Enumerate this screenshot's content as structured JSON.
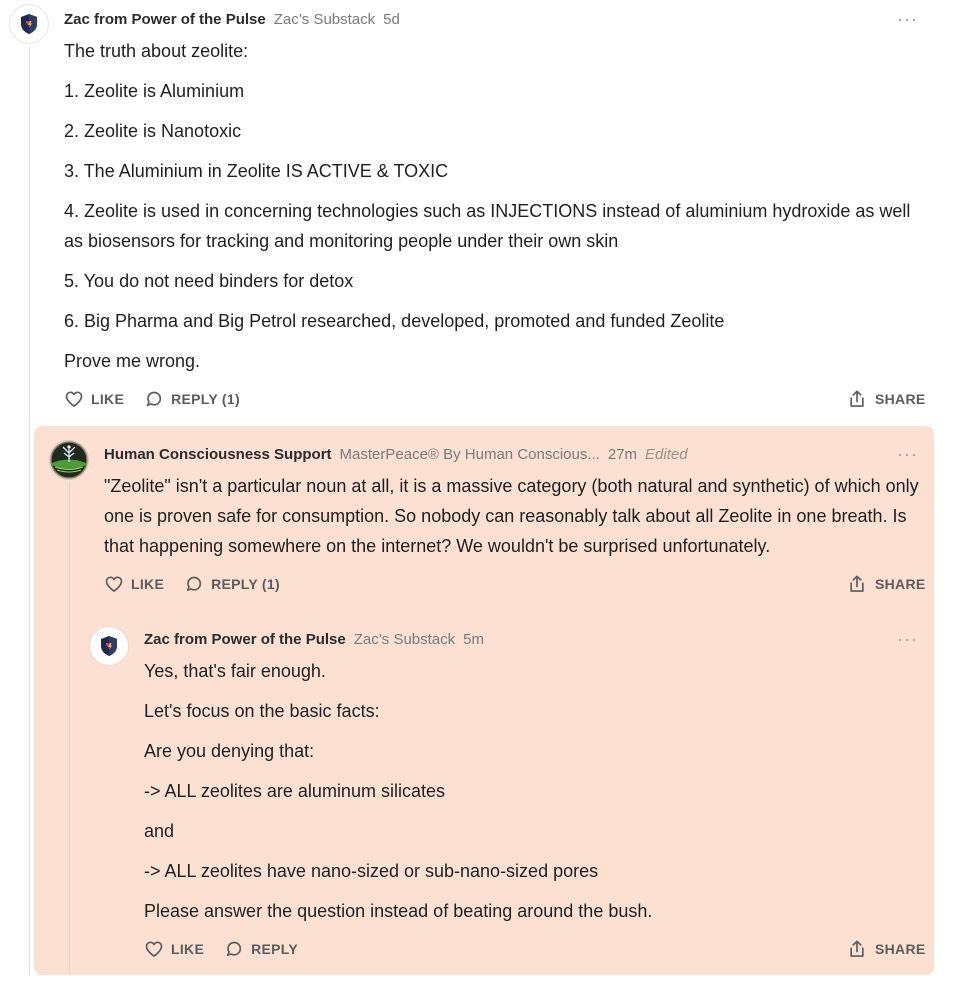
{
  "comment1": {
    "author": "Zac from Power of the Pulse",
    "publication": "Zac’s Substack",
    "time": "5d",
    "paragraphs": [
      "The truth about zeolite:",
      "1. Zeolite is Aluminium",
      "2. Zeolite is Nanotoxic",
      "3. The Aluminium in Zeolite IS ACTIVE & TOXIC",
      "4. Zeolite is used in concerning technologies such as INJECTIONS instead of aluminium hydroxide as well as biosensors for tracking and monitoring people under their own skin",
      "5. You do not need binders for detox",
      "6. Big Pharma and Big Petrol researched, developed, promoted and funded Zeolite",
      "Prove me wrong."
    ],
    "like_label": "LIKE",
    "reply_label": "REPLY (1)",
    "share_label": "SHARE"
  },
  "comment2": {
    "author": "Human Consciousness Support",
    "publication": "MasterPeace® By Human Conscious...",
    "time": "27m",
    "edited": "Edited",
    "paragraphs": [
      "\"Zeolite\" isn't a particular noun at all, it is a massive category (both natural and synthetic) of which only one is proven safe for consumption. So nobody can reasonably talk about all Zeolite in one breath. Is that happening somewhere on the internet? We wouldn't be surprised unfortunately."
    ],
    "like_label": "LIKE",
    "reply_label": "REPLY (1)",
    "share_label": "SHARE"
  },
  "comment3": {
    "author": "Zac from Power of the Pulse",
    "publication": "Zac’s Substack",
    "time": "5m",
    "paragraphs": [
      "Yes, that's fair enough.",
      "Let's focus on the basic facts:",
      "Are you denying that:",
      "-> ALL zeolites are aluminum silicates",
      "and",
      "-> ALL zeolites have nano-sized or sub-nano-sized pores",
      "Please answer the question instead of beating around the bush."
    ],
    "like_label": "LIKE",
    "reply_label": "REPLY",
    "share_label": "SHARE"
  },
  "icons": {
    "more": "more-horizontal-icon",
    "like": "heart-icon",
    "reply": "speech-bubble-icon",
    "share": "share-upload-icon"
  },
  "colors": {
    "highlight": "#fce0d2",
    "action_text": "#5c5c5c"
  }
}
